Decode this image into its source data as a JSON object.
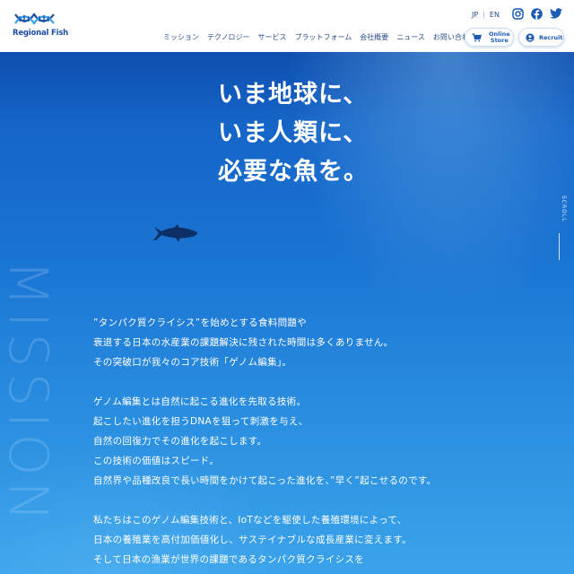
{
  "brand": {
    "name": "Regional Fish"
  },
  "header": {
    "lang": {
      "jp": "JP",
      "sep": "|",
      "en": "EN"
    },
    "nav": [
      "ミッション",
      "テクノロジー",
      "サービス",
      "プラットフォーム",
      "会社概要",
      "ニュース",
      "お問い合わせ"
    ],
    "buttons": {
      "store_line1": "Online",
      "store_line2": "Store",
      "recruit": "Recruit"
    },
    "social_icons": [
      "instagram-icon",
      "facebook-icon",
      "twitter-icon"
    ]
  },
  "hero": {
    "title_lines": [
      "いま地球に、",
      "いま人類に、",
      "必要な魚を。"
    ],
    "scroll_label": "SCROLL",
    "section_bg_word": "MISSION"
  },
  "mission": {
    "paragraphs": [
      [
        "”タンパク質クライシス”を始めとする食料問題や",
        "衰退する日本の水産業の課題解決に残された時間は多くありません。",
        "その突破口が我々のコア技術「ゲノム編集」。"
      ],
      [
        "ゲノム編集とは自然に起こる進化を先取る技術。",
        "起こしたい進化を担うDNAを狙って刺激を与え、",
        "自然の回復力でその進化を起こします。",
        "この技術の価値はスピード。",
        "自然界や品種改良で長い時間をかけて起こった進化を、”早く”起こせるのです。"
      ],
      [
        "私たちはこのゲノム編集技術と、IoTなどを駆使した養殖環境によって、",
        "日本の養殖業を高付加価値化し、サステイナブルな成長産業に変えます。",
        "そして日本の漁業が世界の課題であるタンパク質クライシスを"
      ]
    ]
  },
  "colors": {
    "accent": "#1b5bb5",
    "hero_bg_top": "#0a3f9c",
    "hero_bg_bottom": "#3aa3ea"
  }
}
